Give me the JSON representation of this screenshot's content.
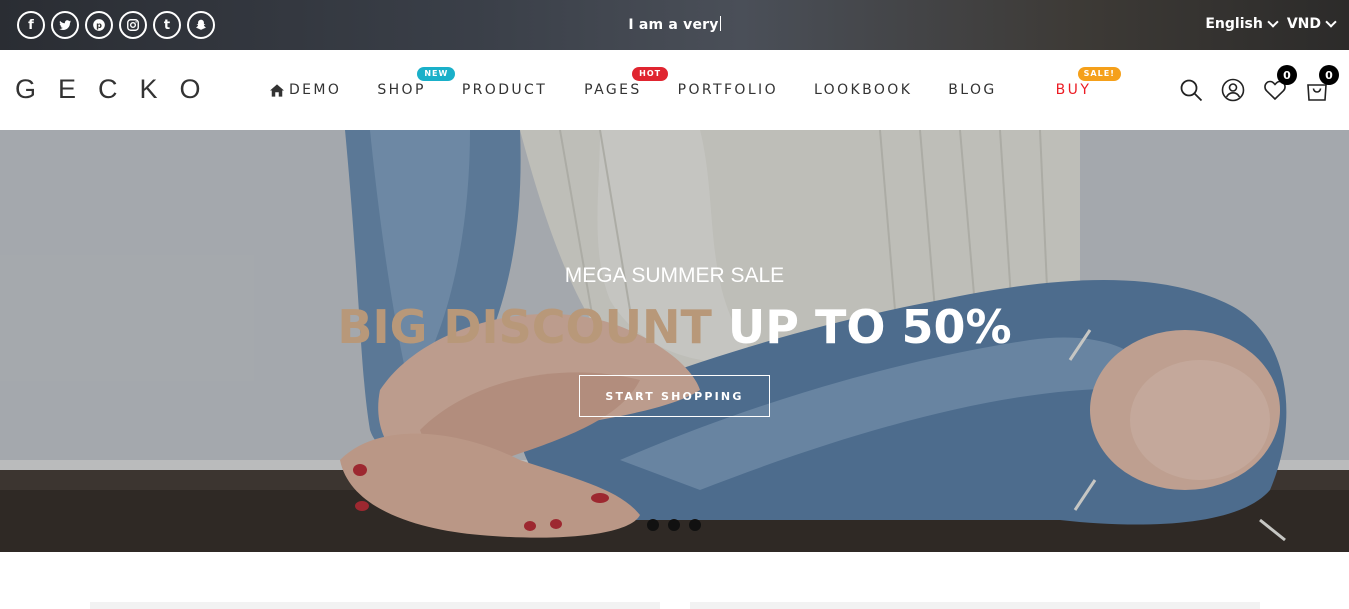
{
  "topbar": {
    "social": [
      "facebook-icon",
      "twitter-icon",
      "pinterest-icon",
      "instagram-icon",
      "tumblr-icon",
      "snapchat-icon"
    ],
    "typed_text": "I am a very",
    "language": "English",
    "currency": "VND"
  },
  "header": {
    "logo": "GECKO",
    "nav": [
      {
        "label": "DEMO",
        "badge": ""
      },
      {
        "label": "SHOP",
        "badge": "NEW"
      },
      {
        "label": "PRODUCT",
        "badge": ""
      },
      {
        "label": "PAGES",
        "badge": "HOT"
      },
      {
        "label": "PORTFOLIO",
        "badge": ""
      },
      {
        "label": "LOOKBOOK",
        "badge": ""
      },
      {
        "label": "BLOG",
        "badge": ""
      },
      {
        "label": "BUY",
        "badge": "SALE!"
      }
    ],
    "wishlist_count": "0",
    "cart_count": "0"
  },
  "hero": {
    "subtitle": "MEGA SUMMER SALE",
    "title_accent": "BIG DISCOUNT",
    "title_rest": "UP TO 50%",
    "button": "START SHOPPING",
    "slides": 3
  },
  "colors": {
    "badge_new": "#1ab0c9",
    "badge_hot": "#e02530",
    "badge_sale": "#f5a01a",
    "buy_red": "#ec1c24",
    "accent_title": "#b89879"
  }
}
